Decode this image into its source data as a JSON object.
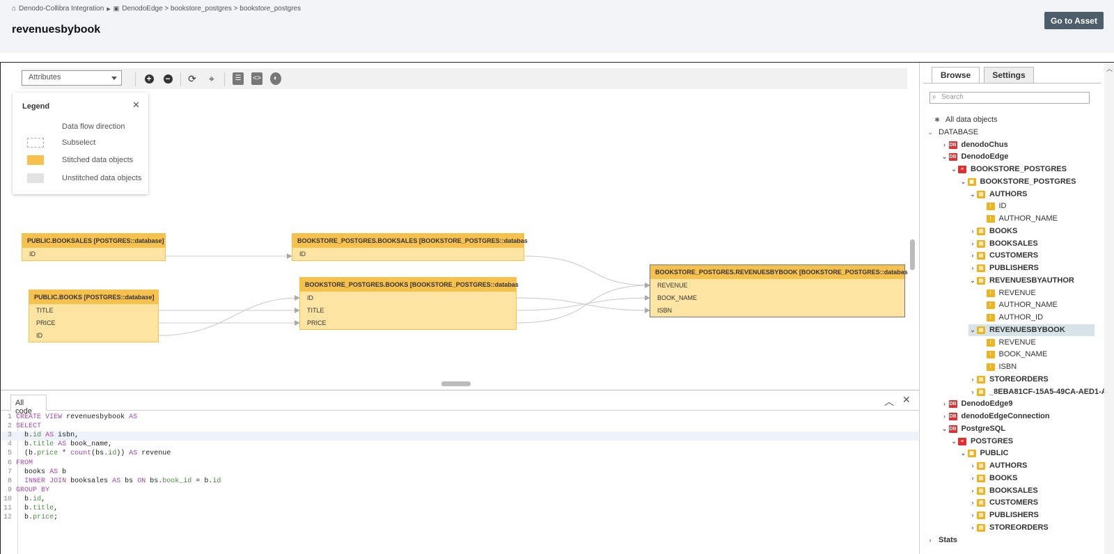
{
  "breadcrumb": {
    "root": "Denodo-Collibra Integration",
    "path": "DenodoEdge > bookstore_postgres > bookstore_postgres"
  },
  "page_title": "revenuesbybook",
  "go_to_asset": "Go to Asset",
  "toolbar": {
    "select_value": "Attributes"
  },
  "legend": {
    "title": "Legend",
    "items": [
      "Data flow direction",
      "Subselect",
      "Stitched data objects",
      "Unstitched data objects"
    ]
  },
  "nodes": {
    "pub_booksales": {
      "title": "PUBLIC.BOOKSALES [POSTGRES::database]",
      "rows": [
        "ID"
      ]
    },
    "bp_booksales": {
      "title": "BOOKSTORE_POSTGRES.BOOKSALES [BOOKSTORE_POSTGRES::databas",
      "rows": [
        "ID"
      ]
    },
    "pub_books": {
      "title": "PUBLIC.BOOKS [POSTGRES::database]",
      "rows": [
        "TITLE",
        "PRICE",
        "ID"
      ]
    },
    "bp_books": {
      "title": "BOOKSTORE_POSTGRES.BOOKS [BOOKSTORE_POSTGRES::databas",
      "rows": [
        "ID",
        "TITLE",
        "PRICE"
      ]
    },
    "bp_revenues": {
      "title": "BOOKSTORE_POSTGRES.REVENUESBYBOOK [BOOKSTORE_POSTGRES::databas",
      "rows": [
        "REVENUE",
        "BOOK_NAME",
        "ISBN"
      ]
    }
  },
  "code": {
    "tab": "All code",
    "lines": [
      "CREATE VIEW revenuesbybook AS",
      "SELECT",
      "  b.id AS isbn,",
      "  b.title AS book_name,",
      "  (b.price * count(bs.id)) AS revenue",
      "FROM",
      "  books AS b",
      "  INNER JOIN booksales AS bs ON bs.book_id = b.id",
      "GROUP BY",
      "  b.id,",
      "  b.title,",
      "  b.price;"
    ]
  },
  "sidebar": {
    "tabs": [
      "Browse",
      "Settings"
    ],
    "search_placeholder": "Search",
    "tree": [
      "All data objects",
      "DATABASE",
      "denodoChus",
      "DenodoEdge",
      "BOOKSTORE_POSTGRES",
      "BOOKSTORE_POSTGRES",
      "AUTHORS",
      "ID",
      "AUTHOR_NAME",
      "BOOKS",
      "BOOKSALES",
      "CUSTOMERS",
      "PUBLISHERS",
      "REVENUESBYAUTHOR",
      "REVENUE",
      "AUTHOR_NAME",
      "AUTHOR_ID",
      "REVENUESBYBOOK",
      "REVENUE",
      "BOOK_NAME",
      "ISBN",
      "STOREORDERS",
      "_8EBA81CF-15A5-49CA-AED1-A",
      "DenodoEdge9",
      "denodoEdgeConnection",
      "PostgreSQL",
      "POSTGRES",
      "PUBLIC",
      "AUTHORS",
      "BOOKS",
      "BOOKSALES",
      "CUSTOMERS",
      "PUBLISHERS",
      "STOREORDERS",
      "Stats"
    ]
  },
  "colors": {
    "stitched": "#f7c14d",
    "unstitched": "#e2e2e2",
    "button": "#4e5d6a",
    "selected_row": "#d6e4ea"
  }
}
